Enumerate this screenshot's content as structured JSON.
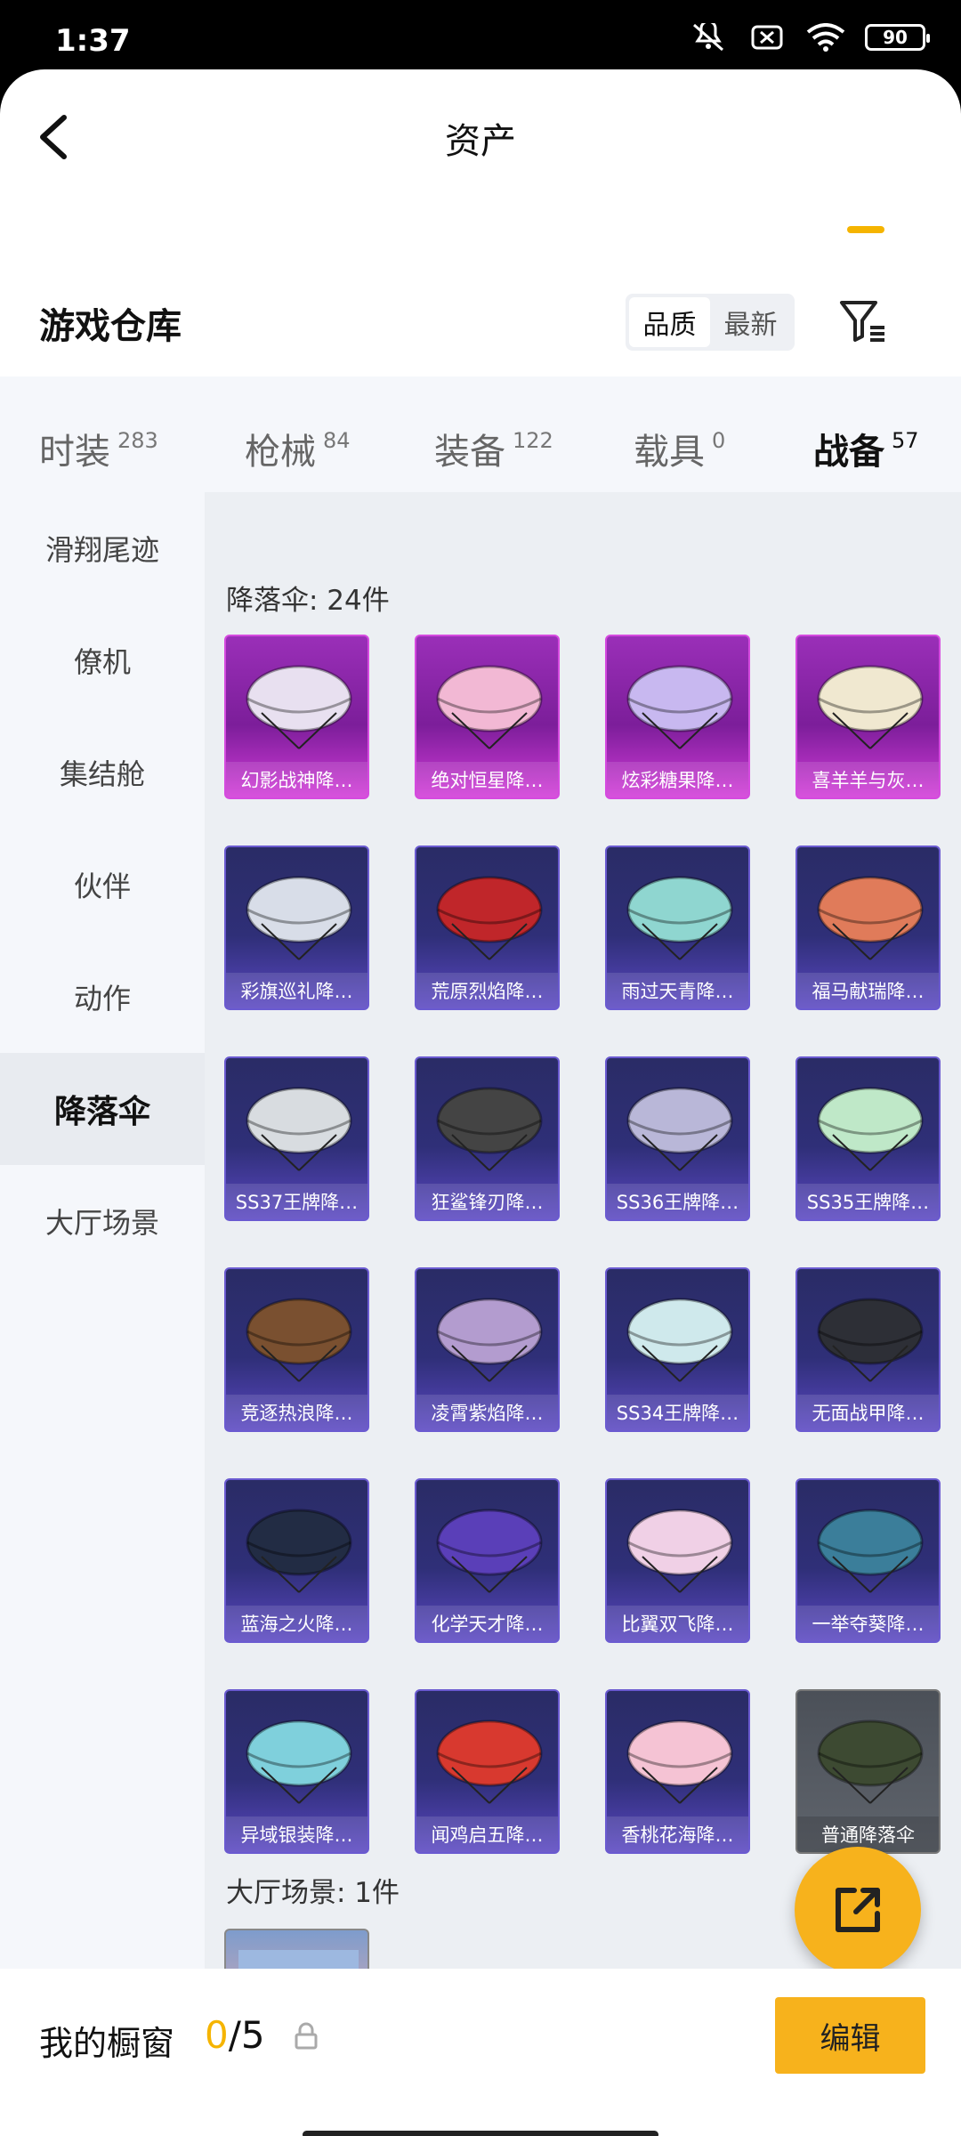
{
  "status_bar": {
    "time": "1:37",
    "battery": "90"
  },
  "header": {
    "title": "资产"
  },
  "warehouse": {
    "title": "游戏仓库",
    "sort_options": [
      "品质",
      "最新"
    ]
  },
  "tabs": [
    {
      "label": "时装",
      "count": "283"
    },
    {
      "label": "枪械",
      "count": "84"
    },
    {
      "label": "装备",
      "count": "122"
    },
    {
      "label": "载具",
      "count": "0"
    },
    {
      "label": "战备",
      "count": "57"
    }
  ],
  "sidebar": {
    "items": [
      "滑翔尾迹",
      "僚机",
      "集结舱",
      "伙伴",
      "动作",
      "降落伞",
      "大厅场景"
    ]
  },
  "sections": {
    "parachute": {
      "heading": "降落伞: 24件",
      "items": [
        {
          "label": "幻影战神降…",
          "rarity": "pink"
        },
        {
          "label": "绝对恒星降…",
          "rarity": "pink"
        },
        {
          "label": "炫彩糖果降…",
          "rarity": "pink"
        },
        {
          "label": "喜羊羊与灰…",
          "rarity": "pink"
        },
        {
          "label": "彩旗巡礼降…",
          "rarity": "purple"
        },
        {
          "label": "荒原烈焰降…",
          "rarity": "purple"
        },
        {
          "label": "雨过天青降…",
          "rarity": "purple"
        },
        {
          "label": "福马献瑞降…",
          "rarity": "purple"
        },
        {
          "label": "SS37王牌降…",
          "rarity": "purple"
        },
        {
          "label": "狂鲨锋刃降…",
          "rarity": "purple"
        },
        {
          "label": "SS36王牌降…",
          "rarity": "purple"
        },
        {
          "label": "SS35王牌降…",
          "rarity": "purple"
        },
        {
          "label": "竞逐热浪降…",
          "rarity": "purple"
        },
        {
          "label": "凌霄紫焰降…",
          "rarity": "purple"
        },
        {
          "label": "SS34王牌降…",
          "rarity": "purple"
        },
        {
          "label": "无面战甲降…",
          "rarity": "purple"
        },
        {
          "label": "蓝海之火降…",
          "rarity": "purple"
        },
        {
          "label": "化学天才降…",
          "rarity": "purple"
        },
        {
          "label": "比翼双飞降…",
          "rarity": "purple"
        },
        {
          "label": "一举夺葵降…",
          "rarity": "purple"
        },
        {
          "label": "异域银装降…",
          "rarity": "purple"
        },
        {
          "label": "闻鸡启五降…",
          "rarity": "purple"
        },
        {
          "label": "香桃花海降…",
          "rarity": "purple"
        },
        {
          "label": "普通降落伞",
          "rarity": "gray"
        }
      ]
    },
    "lobby": {
      "heading": "大厅场景: 1件"
    }
  },
  "bottom_bar": {
    "label": "我的橱窗",
    "count_current": "0",
    "count_total": "/5",
    "edit_label": "编辑"
  },
  "colors": {
    "accent": "#f7b21c",
    "pink_rarity": "#9a2fb8",
    "purple_rarity": "#2f2f78"
  }
}
